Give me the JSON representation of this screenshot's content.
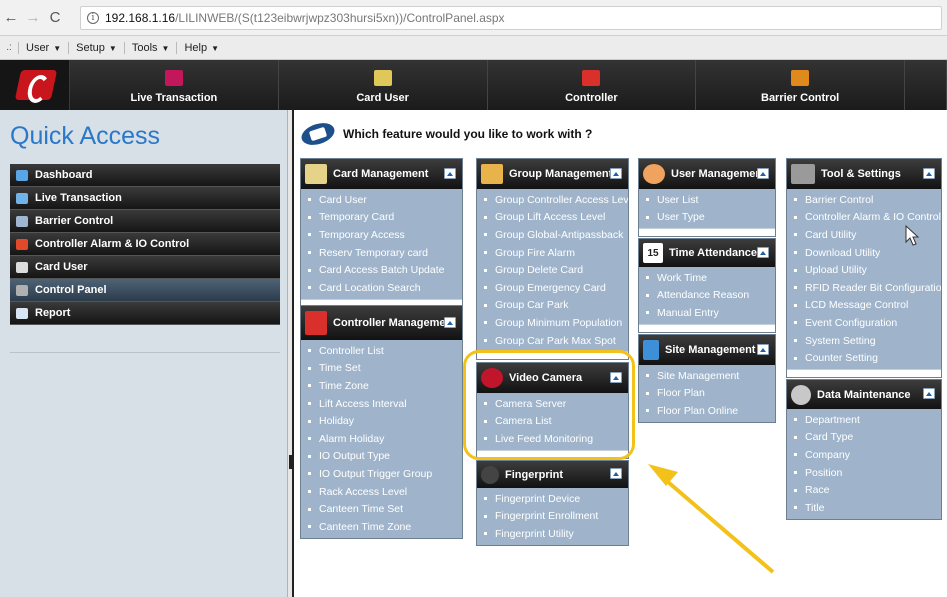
{
  "browser": {
    "url_host": "192.168.1.16",
    "url_path": "/LILINWEB/(S(t123eibwrjwpz303hursi5xn))/ControlPanel.aspx"
  },
  "menubar": {
    "items": [
      "User",
      "Setup",
      "Tools",
      "Help"
    ]
  },
  "topnav": {
    "items": [
      "Live Transaction",
      "Card User",
      "Controller",
      "Barrier Control"
    ]
  },
  "sidebar": {
    "title": "Quick Access",
    "items": [
      "Dashboard",
      "Live Transaction",
      "Barrier Control",
      "Controller Alarm & IO Control",
      "Card User",
      "Control Panel",
      "Report"
    ]
  },
  "main": {
    "heading": "Which feature would you like to work with ?",
    "panels": {
      "card_management": {
        "title": "Card Management",
        "links": [
          "Card User",
          "Temporary Card",
          "Temporary Access",
          "Reserv Temporary card",
          "Card Access Batch Update",
          "Card Location Search"
        ]
      },
      "controller_management": {
        "title": "Controller Management",
        "links": [
          "Controller List",
          "Time Set",
          "Time Zone",
          "Lift Access Interval",
          "Holiday",
          "Alarm Holiday",
          "IO Output Type",
          "IO Output Trigger Group",
          "Rack Access Level",
          "Canteen Time Set",
          "Canteen Time Zone"
        ]
      },
      "group_management": {
        "title": "Group Management",
        "links": [
          "Group Controller Access Level",
          "Group Lift Access Level",
          "Group Global-Antipassback",
          "Group Fire Alarm",
          "Group Delete Card",
          "Group Emergency Card",
          "Group Car Park",
          "Group Minimum Population",
          "Group Car Park Max Spot"
        ]
      },
      "video_camera": {
        "title": "Video Camera",
        "links": [
          "Camera Server",
          "Camera List",
          "Live Feed Monitoring"
        ]
      },
      "fingerprint": {
        "title": "Fingerprint",
        "links": [
          "Fingerprint Device",
          "Fingerprint Enrollment",
          "Fingerprint Utility"
        ]
      },
      "user_management": {
        "title": "User Management",
        "links": [
          "User List",
          "User Type"
        ]
      },
      "time_attendance": {
        "title": "Time Attendance",
        "calendar_day": "15",
        "links": [
          "Work Time",
          "Attendance Reason",
          "Manual Entry"
        ]
      },
      "site_management": {
        "title": "Site Management",
        "links": [
          "Site Management",
          "Floor Plan",
          "Floor Plan Online"
        ]
      },
      "tool_settings": {
        "title": "Tool & Settings",
        "links": [
          "Barrier Control",
          "Controller Alarm & IO Control",
          "Card Utility",
          "Download Utility",
          "Upload Utility",
          "RFID Reader Bit Configuration",
          "LCD Message Control",
          "Event Configuration",
          "System Setting",
          "Counter Setting"
        ]
      },
      "data_maintenance": {
        "title": "Data Maintenance",
        "links": [
          "Department",
          "Card Type",
          "Company",
          "Position",
          "Race",
          "Title"
        ]
      }
    }
  },
  "colors": {
    "panel_body": "#9fb4cb",
    "header_dark": "#1f1f1f",
    "accent_blue": "#2a78c8",
    "highlight": "#f2c21a"
  }
}
